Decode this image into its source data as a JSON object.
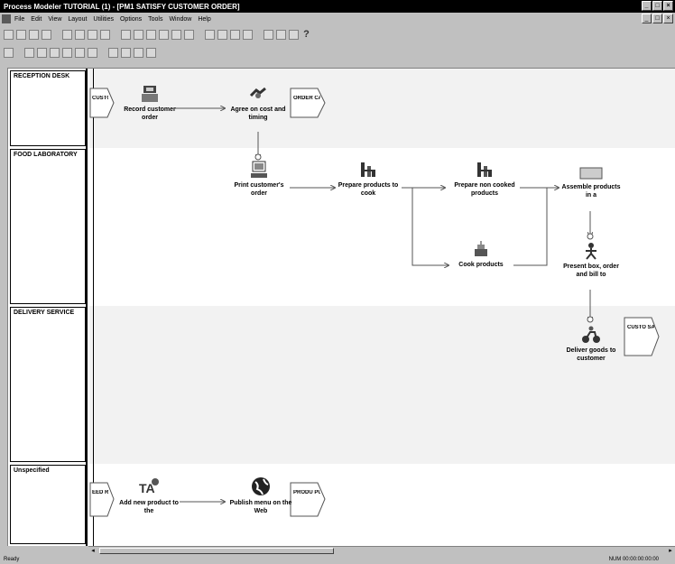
{
  "window": {
    "title": "Process Modeler TUTORIAL (1) - [PM1 SATISFY CUSTOMER ORDER]"
  },
  "menu": {
    "items": [
      "File",
      "Edit",
      "View",
      "Layout",
      "Utilities",
      "Options",
      "Tools",
      "Window",
      "Help"
    ]
  },
  "lanes": [
    {
      "label": "RECEPTION DESK"
    },
    {
      "label": "FOOD LABORATORY"
    },
    {
      "label": "DELIVERY SERVICE"
    },
    {
      "label": "Unspecified"
    }
  ],
  "activities": {
    "record": "Record customer order",
    "agree": "Agree on cost and timing",
    "print": "Print customer's order",
    "prepare": "Prepare products to cook",
    "prepare_non": "Prepare non cooked products",
    "assemble": "Assemble products in a",
    "cook": "Cook products",
    "present": "Present box, order and bill to",
    "deliver": "Deliver goods to customer",
    "add_product": "Add new product to the",
    "publish": "Publish menu on the Web"
  },
  "flows": {
    "customer_in": "CUSTO DAKS KED",
    "order_cancel": "ORDER CANCEL",
    "customer_satisfied": "CUSTO SATISF WITH",
    "need_in": "EED RI PME",
    "product_public": "PRODU PUBLIC"
  },
  "status": {
    "left": "Ready",
    "right": "NUM  00:00:00:00:00"
  },
  "colors": {
    "titlebar": "#000000",
    "window": "#c0c0c0",
    "canvas": "#ffffff",
    "lane_alt": "#f2f2f2"
  }
}
